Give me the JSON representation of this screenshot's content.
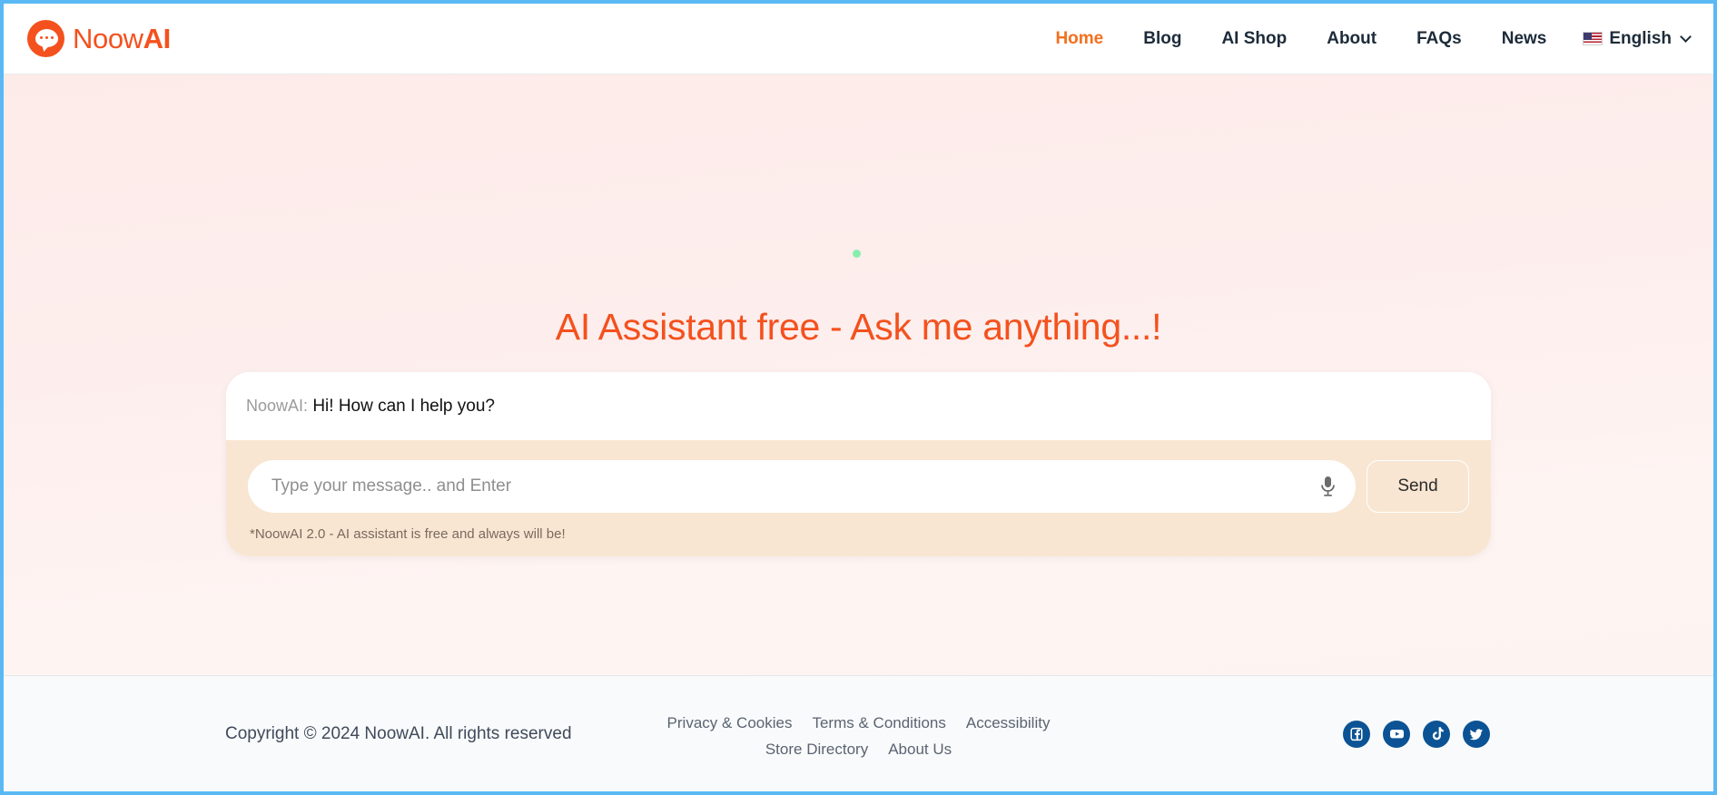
{
  "brand": {
    "name_light": "Noow",
    "name_bold": "AI",
    "logo_icon": "chat-bubble-logo-icon"
  },
  "nav": {
    "items": [
      {
        "label": "Home",
        "active": true
      },
      {
        "label": "Blog",
        "active": false
      },
      {
        "label": "AI Shop",
        "active": false
      },
      {
        "label": "About",
        "active": false
      },
      {
        "label": "FAQs",
        "active": false
      },
      {
        "label": "News",
        "active": false
      }
    ],
    "language": {
      "label": "English",
      "flag_icon": "us-flag-icon",
      "chevron_icon": "chevron-down-icon"
    }
  },
  "hero": {
    "title": "AI Assistant free - Ask me anything...!",
    "status_dot_color": "#86efac"
  },
  "chat": {
    "message": {
      "sender": "NoowAI:",
      "text": "Hi! How can I help you?"
    },
    "input": {
      "value": "",
      "placeholder": "Type your message.. and Enter"
    },
    "mic_icon": "microphone-icon",
    "send_label": "Send",
    "disclaimer": "*NoowAI 2.0 - AI assistant is free and always will be!"
  },
  "footer": {
    "copyright": "Copyright © 2024 NoowAI. All rights reserved",
    "links_row1": [
      {
        "label": "Privacy & Cookies"
      },
      {
        "label": "Terms & Conditions"
      },
      {
        "label": "Accessibility"
      }
    ],
    "links_row2": [
      {
        "label": "Store Directory"
      },
      {
        "label": "About Us"
      }
    ],
    "socials": [
      {
        "name": "facebook-icon"
      },
      {
        "name": "youtube-icon"
      },
      {
        "name": "tiktok-icon"
      },
      {
        "name": "twitter-icon"
      }
    ],
    "social_color": "#0b5394"
  },
  "theme": {
    "accent": "#f4511e",
    "nav_active": "#f4701e",
    "hero_bg": "#fdeceb",
    "composer_bg": "#f8e6d2",
    "footer_bg": "#f9fafb"
  }
}
